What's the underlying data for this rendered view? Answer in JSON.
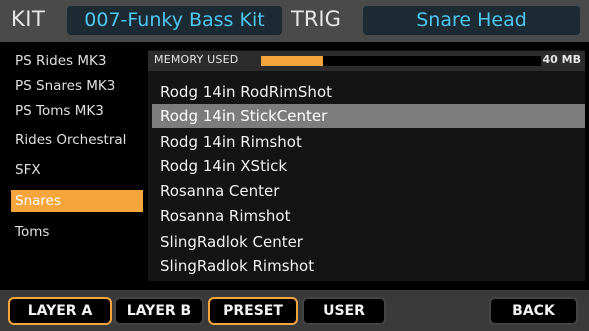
{
  "header": {
    "kit_label": "KIT",
    "kit_name": "007-Funky Bass Kit",
    "trig_label": "TRIG",
    "trig_name": "Snare Head"
  },
  "categories": [
    {
      "label": "PS Rides MK3",
      "selected": false
    },
    {
      "label": "PS Snares MK3",
      "selected": false
    },
    {
      "label": "PS Toms MK3",
      "selected": false
    },
    {
      "label": "Rides Orchestral",
      "selected": false
    },
    {
      "label": "SFX",
      "selected": false
    },
    {
      "label": "Snares",
      "selected": true
    },
    {
      "label": "Toms",
      "selected": false
    }
  ],
  "memory": {
    "label": "MEMORY USED",
    "value": "40 MB",
    "used_fraction": 0.22
  },
  "instruments": [
    {
      "label": "Rodg 14in RodRimShot",
      "selected": false
    },
    {
      "label": "Rodg 14in StickCenter",
      "selected": true
    },
    {
      "label": "Rodg 14in Rimshot",
      "selected": false
    },
    {
      "label": "Rodg 14in XStick",
      "selected": false
    },
    {
      "label": "Rosanna Center",
      "selected": false
    },
    {
      "label": "Rosanna Rimshot",
      "selected": false
    },
    {
      "label": "SlingRadlok Center",
      "selected": false
    },
    {
      "label": "SlingRadlok Rimshot",
      "selected": false
    }
  ],
  "buttons": {
    "layer_a": "LAYER A",
    "layer_b": "LAYER B",
    "preset": "PRESET",
    "user": "USER",
    "back": "BACK"
  },
  "active_buttons": [
    "layer_a",
    "preset"
  ],
  "colors": {
    "accent": "#f5a53b",
    "value_text": "#4fc6f0"
  }
}
